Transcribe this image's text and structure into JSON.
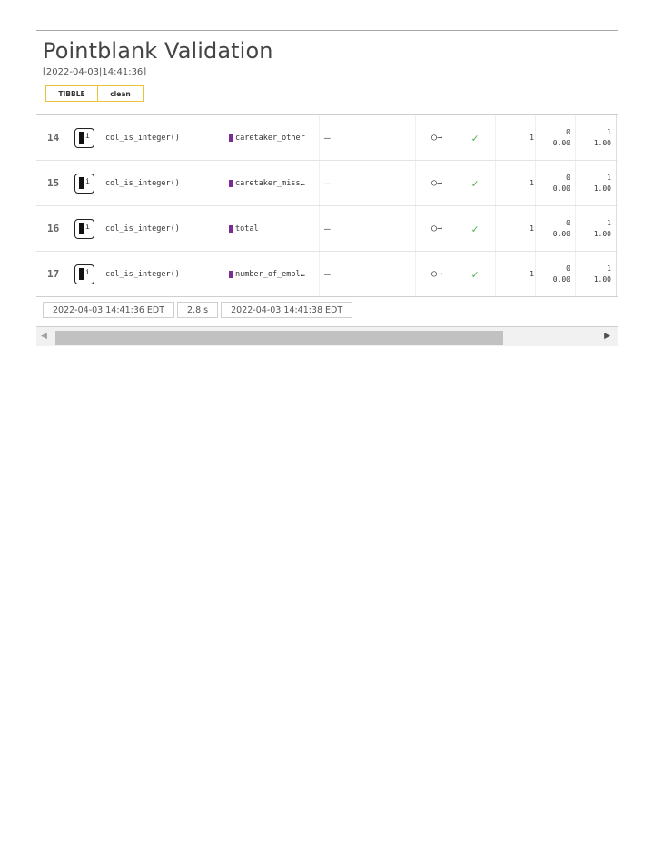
{
  "header": {
    "title": "Pointblank Validation",
    "timestamp": "[2022-04-03|14:41:36]",
    "badge_type": "TIBBLE",
    "badge_name": "clean"
  },
  "rows": [
    {
      "step": "14",
      "info_icon": "i",
      "function": "col_is_integer()",
      "column": "caretaker_other",
      "values": "—",
      "precondition": "○→",
      "eval": "✓",
      "units": "1",
      "pass_n": "0",
      "pass_frac": "0.00",
      "fail_n": "1",
      "fail_frac": "1.00"
    },
    {
      "step": "15",
      "info_icon": "i",
      "function": "col_is_integer()",
      "column": "caretaker_miss…",
      "values": "—",
      "precondition": "○→",
      "eval": "✓",
      "units": "1",
      "pass_n": "0",
      "pass_frac": "0.00",
      "fail_n": "1",
      "fail_frac": "1.00"
    },
    {
      "step": "16",
      "info_icon": "i",
      "function": "col_is_integer()",
      "column": "total",
      "values": "—",
      "precondition": "○→",
      "eval": "✓",
      "units": "1",
      "pass_n": "0",
      "pass_frac": "0.00",
      "fail_n": "1",
      "fail_frac": "1.00"
    },
    {
      "step": "17",
      "info_icon": "i",
      "function": "col_is_integer()",
      "column": "number_of_empl…",
      "values": "—",
      "precondition": "○→",
      "eval": "✓",
      "units": "1",
      "pass_n": "0",
      "pass_frac": "0.00",
      "fail_n": "1",
      "fail_frac": "1.00"
    }
  ],
  "footer": {
    "start_time": "2022-04-03 14:41:36 EDT",
    "duration": "2.8 s",
    "end_time": "2022-04-03 14:41:38 EDT"
  },
  "scrollbar": {
    "left_arrow": "◀",
    "right_arrow": "▶"
  },
  "colors": {
    "column_swatch": "#7b2b93",
    "eval_check": "#4caf50",
    "badge_border": "#e8c13d"
  }
}
